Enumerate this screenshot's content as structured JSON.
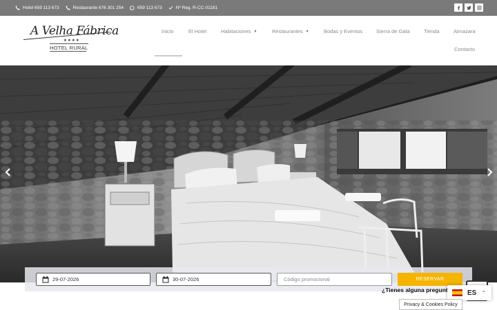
{
  "topbar": {
    "contacts": [
      {
        "icon": "phone-icon",
        "text": "Hotel 659 113 673"
      },
      {
        "icon": "phone-icon",
        "text": "Restaurante 676 301 254"
      },
      {
        "icon": "whatsapp-icon",
        "text": "659 113 673"
      },
      {
        "icon": "check-icon",
        "text": "Nº Reg. R-CC-01181"
      }
    ],
    "social": [
      "facebook-icon",
      "twitter-icon",
      "instagram-icon"
    ]
  },
  "logo": {
    "script": "A Velha Fábrica",
    "stars": "★★★★",
    "subtitle": "HOTEL RURAL"
  },
  "nav": {
    "items": [
      {
        "label": "Inicio",
        "active": true
      },
      {
        "label": "El Hotel"
      },
      {
        "label": "Habitaciones",
        "dropdown": true
      },
      {
        "label": "Restaurantes",
        "dropdown": true
      },
      {
        "label": "Bodas y Eventos"
      },
      {
        "label": "Sierra de Gata"
      },
      {
        "label": "Tienda"
      },
      {
        "label": "Almazara"
      },
      {
        "label": "Contacto"
      }
    ]
  },
  "booking": {
    "checkin": "29-07-2026",
    "checkout": "30-07-2026",
    "promo_placeholder": "Código promocional",
    "reserve_label": "RESERVAR"
  },
  "chat": {
    "question": "¿Tienes alguna pregunta?"
  },
  "language": {
    "code": "ES"
  },
  "privacy": {
    "label": "Privacy & Cookies Policy"
  },
  "colors": {
    "topbar": "#7a7a7a",
    "accent": "#f5b400",
    "nav_text": "#8a8a8a"
  }
}
